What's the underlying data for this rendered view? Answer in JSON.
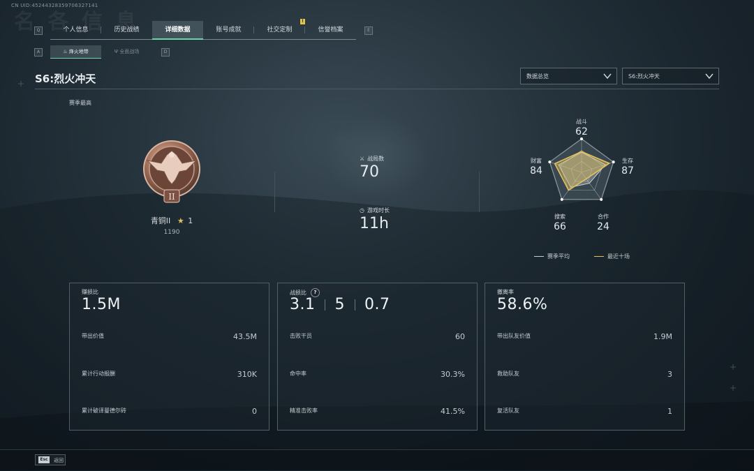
{
  "header": {
    "uid": "CN UID:45244328359706327141",
    "tabs": [
      {
        "label": "个人信息"
      },
      {
        "label": "历史战绩"
      },
      {
        "label": "详细数据"
      },
      {
        "label": "账号成就"
      },
      {
        "label": "社交定制"
      },
      {
        "label": "信誉档案"
      }
    ],
    "active_tab": "详细数据",
    "tab_badge": "!",
    "key_left": "Q",
    "key_right": "E"
  },
  "subtabs": {
    "key_left": "A",
    "key_right": "D",
    "items": [
      {
        "label": "烽火地带",
        "icon": "campfire-icon"
      },
      {
        "label": "全面战场",
        "icon": "antenna-icon"
      }
    ],
    "active": "烽火地带"
  },
  "season": {
    "title": "S6:烈火冲天",
    "dropdown_overview": "数据总览",
    "dropdown_season": "S6:烈火冲天",
    "best_label": "赛季最高"
  },
  "rank": {
    "name": "青铜II",
    "stars": "1",
    "points": "1190",
    "emblem_numeral": "II"
  },
  "match_stats": {
    "matches_label": "战局数",
    "matches_value": "70",
    "playtime_label": "游戏时长",
    "playtime_value": "11h"
  },
  "radar": {
    "axes": [
      {
        "label": "战斗",
        "value": "62"
      },
      {
        "label": "生存",
        "value": "87"
      },
      {
        "label": "合作",
        "value": "24"
      },
      {
        "label": "搜索",
        "value": "66"
      },
      {
        "label": "财富",
        "value": "84"
      }
    ],
    "season_avg_values": [
      60,
      75,
      40,
      55,
      72
    ],
    "recent_values": [
      62,
      87,
      24,
      66,
      84
    ],
    "legend_season_avg": "赛季平均",
    "legend_recent": "最近十场",
    "color_season_avg": "#c9d0d4",
    "color_recent": "#e3c15e"
  },
  "cards": [
    {
      "title": "赚损比",
      "value": "1.5M",
      "rows": [
        {
          "label": "带出价值",
          "value": "43.5M"
        },
        {
          "label": "累计行动报酬",
          "value": "310K"
        },
        {
          "label": "累计破译曼德尔砖",
          "value": "0"
        }
      ]
    },
    {
      "title": "战损比",
      "help": "?",
      "value_a": "3.1",
      "value_b": "5",
      "value_c": "0.7",
      "rows": [
        {
          "label": "击败干员",
          "value": "60"
        },
        {
          "label": "命中率",
          "value": "30.3%"
        },
        {
          "label": "精准击败率",
          "value": "41.5%"
        }
      ]
    },
    {
      "title": "撤离率",
      "value": "58.6%",
      "rows": [
        {
          "label": "带出队友价值",
          "value": "1.9M"
        },
        {
          "label": "救助队友",
          "value": "3"
        },
        {
          "label": "复活队友",
          "value": "1"
        }
      ]
    }
  ],
  "footer": {
    "esc_key": "Esc",
    "back_label": "返回"
  },
  "colors": {
    "accent_green": "#6fd3a8",
    "gold": "#e3c15e"
  }
}
